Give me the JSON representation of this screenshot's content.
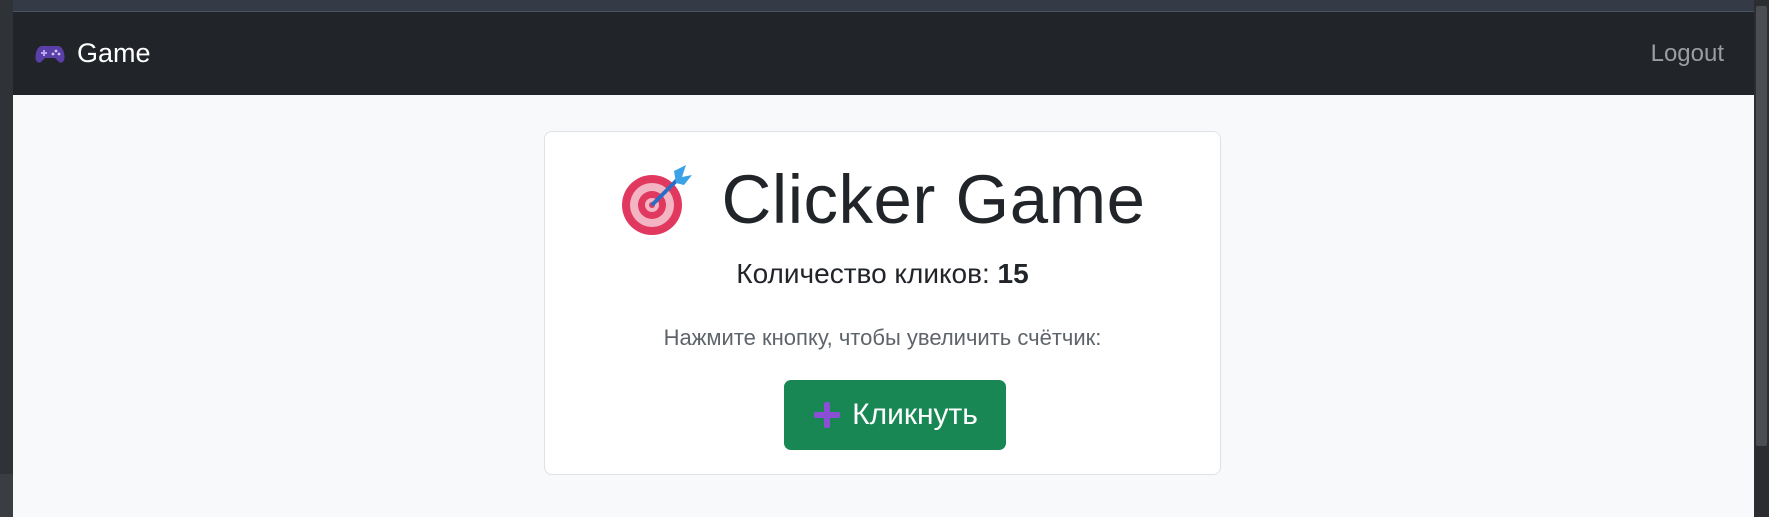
{
  "navbar": {
    "brand_icon": "gamepad-icon",
    "brand_text": "Game",
    "logout_label": "Logout"
  },
  "card": {
    "title_icon": "target-dart-icon",
    "title": "Clicker Game",
    "count_label": "Количество кликов:",
    "count_value": "15",
    "hint": "Нажмите кнопку, чтобы увеличить счётчик:",
    "button_icon": "plus-icon",
    "button_label": "Кликнуть"
  },
  "colors": {
    "navbar_bg": "#212529",
    "page_bg": "#f8f9fa",
    "button_bg": "#198754",
    "plus_icon": "#8b4fd6",
    "target_red": "#e0385e"
  }
}
